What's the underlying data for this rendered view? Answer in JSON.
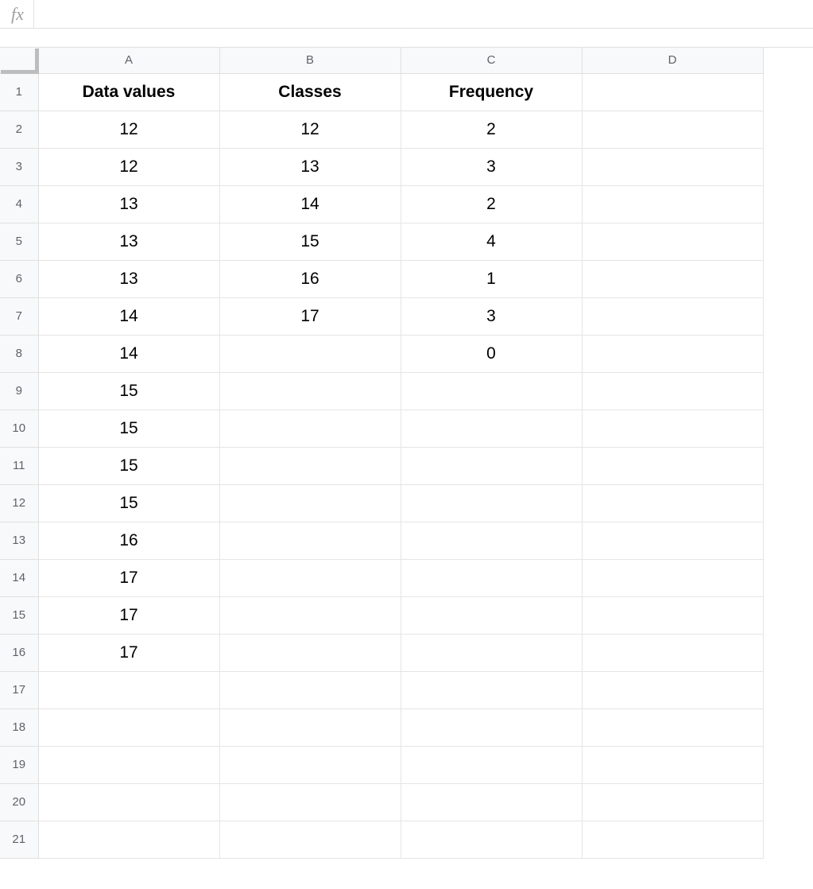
{
  "formula_bar": {
    "fx_label": "fx",
    "input_value": ""
  },
  "columns": [
    "A",
    "B",
    "C",
    "D"
  ],
  "row_count": 21,
  "cells": {
    "A1": {
      "value": "Data values",
      "bold": true
    },
    "B1": {
      "value": "Classes",
      "bold": true
    },
    "C1": {
      "value": "Frequency",
      "bold": true
    },
    "A2": {
      "value": "12"
    },
    "B2": {
      "value": "12"
    },
    "C2": {
      "value": "2"
    },
    "A3": {
      "value": "12"
    },
    "B3": {
      "value": "13"
    },
    "C3": {
      "value": "3"
    },
    "A4": {
      "value": "13"
    },
    "B4": {
      "value": "14"
    },
    "C4": {
      "value": "2"
    },
    "A5": {
      "value": "13"
    },
    "B5": {
      "value": "15"
    },
    "C5": {
      "value": "4"
    },
    "A6": {
      "value": "13"
    },
    "B6": {
      "value": "16"
    },
    "C6": {
      "value": "1"
    },
    "A7": {
      "value": "14"
    },
    "B7": {
      "value": "17"
    },
    "C7": {
      "value": "3"
    },
    "A8": {
      "value": "14"
    },
    "C8": {
      "value": "0"
    },
    "A9": {
      "value": "15"
    },
    "A10": {
      "value": "15"
    },
    "A11": {
      "value": "15"
    },
    "A12": {
      "value": "15"
    },
    "A13": {
      "value": "16"
    },
    "A14": {
      "value": "17"
    },
    "A15": {
      "value": "17"
    },
    "A16": {
      "value": "17"
    }
  }
}
